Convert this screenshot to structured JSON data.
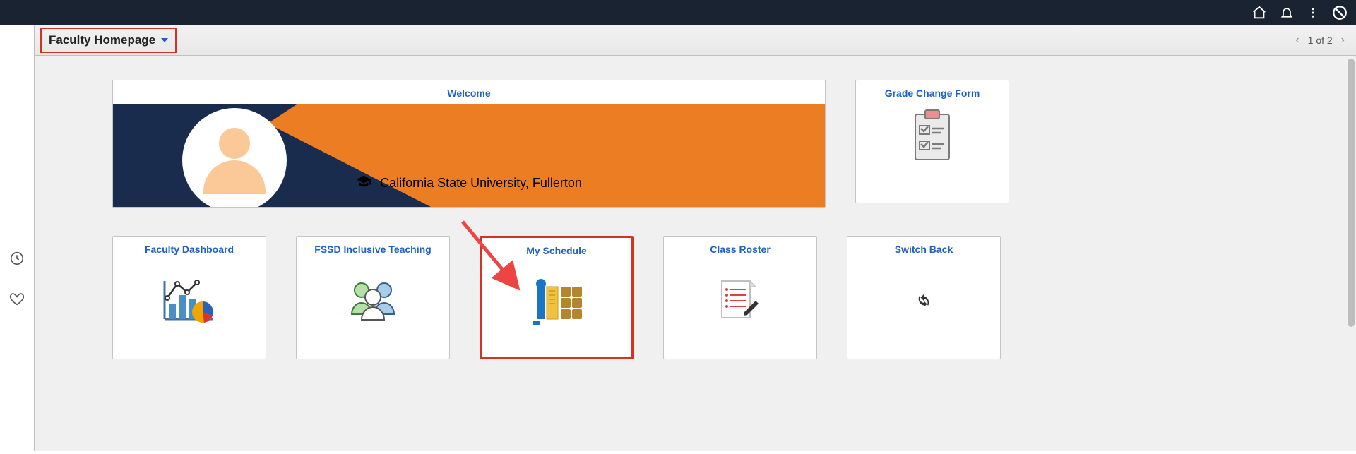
{
  "header": {
    "icons": [
      "home",
      "notifications",
      "more",
      "logout"
    ]
  },
  "page_selector": {
    "label": "Faculty Homepage"
  },
  "pager": {
    "text": "1 of 2"
  },
  "welcome": {
    "title": "Welcome",
    "institution": "California State University, Fullerton"
  },
  "tiles": {
    "grade_change": {
      "title": "Grade Change Form"
    },
    "faculty_dashboard": {
      "title": "Faculty Dashboard"
    },
    "fssd": {
      "title": "FSSD Inclusive Teaching"
    },
    "my_schedule": {
      "title": "My Schedule"
    },
    "class_roster": {
      "title": "Class Roster"
    },
    "switch_back": {
      "title": "Switch Back"
    }
  },
  "left_rail": {
    "items": [
      "recent",
      "favorites"
    ]
  }
}
